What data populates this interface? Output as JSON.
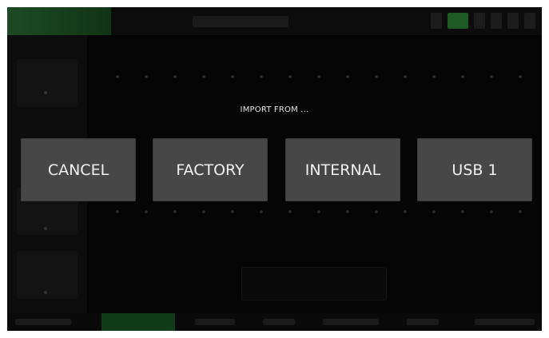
{
  "dialog": {
    "title": "IMPORT FROM ...",
    "buttons": [
      {
        "label": "CANCEL"
      },
      {
        "label": "FACTORY"
      },
      {
        "label": "INTERNAL"
      },
      {
        "label": "USB 1"
      }
    ]
  },
  "colors": {
    "button_bg": "#474747",
    "accent_green": "#1e5a24",
    "screen_bg": "#050505"
  }
}
